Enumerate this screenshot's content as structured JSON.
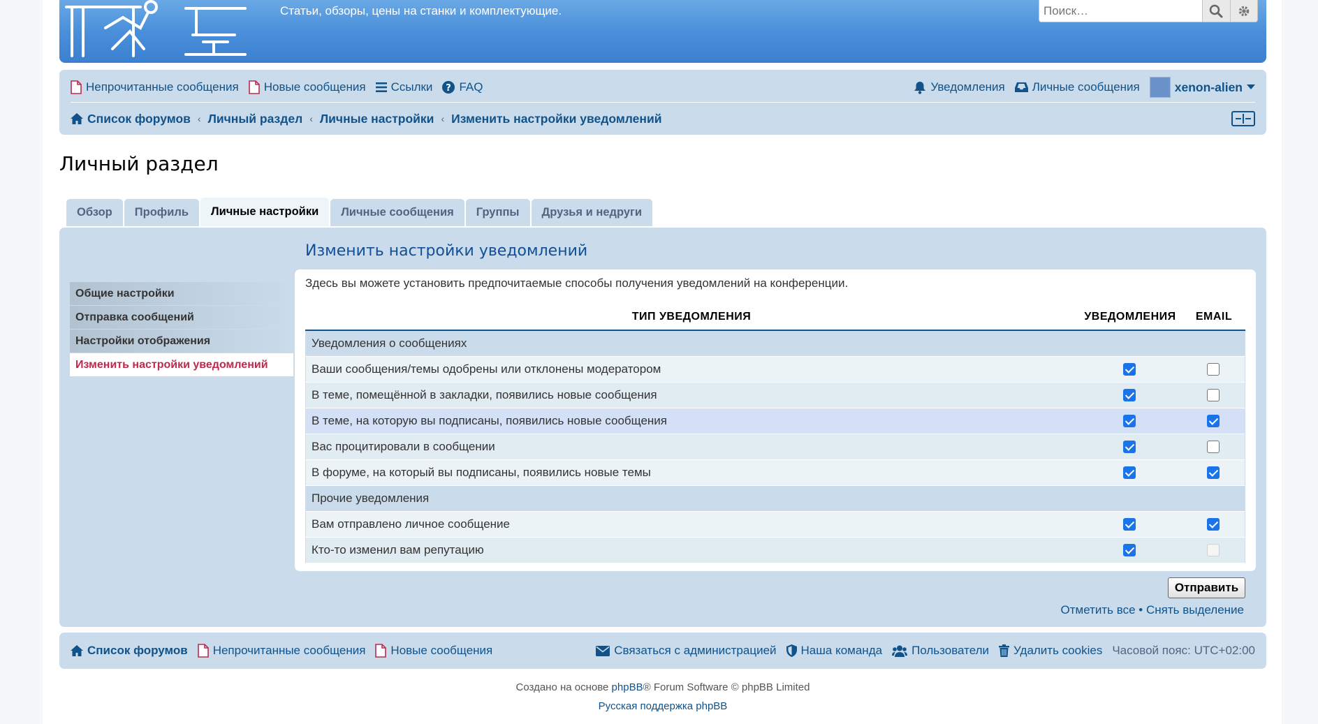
{
  "header": {
    "site_description": "Статьи, обзоры, цены на станки и комплектующие.",
    "search_placeholder": "Поиск…",
    "icons": [
      "search-icon",
      "gear-icon"
    ]
  },
  "navbar": {
    "unread_posts": "Непрочитанные сообщения",
    "new_posts": "Новые сообщения",
    "links": "Ссылки",
    "faq": "FAQ",
    "notifications": "Уведомления",
    "private_messages": "Личные сообщения",
    "username": "xenon-alien"
  },
  "breadcrumbs": [
    "Список форумов",
    "Личный раздел",
    "Личные настройки",
    "Изменить настройки уведомлений"
  ],
  "page_title": "Личный раздел",
  "tabs": [
    {
      "label": "Обзор",
      "active": false
    },
    {
      "label": "Профиль",
      "active": false
    },
    {
      "label": "Личные настройки",
      "active": true
    },
    {
      "label": "Личные сообщения",
      "active": false
    },
    {
      "label": "Группы",
      "active": false
    },
    {
      "label": "Друзья и недруги",
      "active": false
    }
  ],
  "side_menu": [
    {
      "label": "Общие настройки",
      "active": false
    },
    {
      "label": "Отправка сообщений",
      "active": false
    },
    {
      "label": "Настройки отображения",
      "active": false
    },
    {
      "label": "Изменить настройки уведомлений",
      "active": true
    }
  ],
  "section_title": "Изменить настройки уведомлений",
  "description": "Здесь вы можете установить предпочитаемые способы получения уведомлений на конференции.",
  "table": {
    "headers": {
      "type": "ТИП УВЕДОМЛЕНИЯ",
      "notifications": "УВЕДОМЛЕНИЯ",
      "email": "EMAIL"
    },
    "rows": [
      {
        "kind": "group",
        "label": "Уведомления о сообщениях"
      },
      {
        "kind": "item",
        "label": "Ваши сообщения/темы одобрены или отклонены модератором",
        "notify": true,
        "email": false
      },
      {
        "kind": "item",
        "label": "В теме, помещённой в закладки, появились новые сообщения",
        "notify": true,
        "email": false
      },
      {
        "kind": "item",
        "label": "В теме, на которую вы подписаны, появились новые сообщения",
        "notify": true,
        "email": true,
        "highlighted": true
      },
      {
        "kind": "item",
        "label": "Вас процитировали в сообщении",
        "notify": true,
        "email": false
      },
      {
        "kind": "item",
        "label": "В форуме, на который вы подписаны, появились новые темы",
        "notify": true,
        "email": true
      },
      {
        "kind": "group",
        "label": "Прочие уведомления"
      },
      {
        "kind": "item",
        "label": "Вам отправлено личное сообщение",
        "notify": true,
        "email": true
      },
      {
        "kind": "item",
        "label": "Кто-то изменил вам репутацию",
        "notify": true,
        "email": false,
        "email_disabled": true
      }
    ]
  },
  "actions": {
    "submit": "Отправить",
    "mark_all": "Отметить все",
    "separator": "•",
    "unmark_all": "Снять выделение"
  },
  "footer_nav": {
    "forum_index": "Список форумов",
    "unread_posts": "Непрочитанные сообщения",
    "new_posts": "Новые сообщения",
    "contact": "Связаться с администрацией",
    "team": "Наша команда",
    "members": "Пользователи",
    "delete_cookies": "Удалить cookies",
    "timezone": "Часовой пояс: UTC+02:00"
  },
  "copyright": {
    "prefix": "Создано на основе ",
    "phpbb": "phpBB",
    "suffix": "® Forum Software © phpBB Limited",
    "russian_support": "Русская поддержка phpBB"
  },
  "colors": {
    "header_blue": "#4a8fda",
    "nav_bg": "#cadceb",
    "link": "#105289",
    "active_menu": "#bc2a4d",
    "checkbox": "#1a73e8"
  }
}
